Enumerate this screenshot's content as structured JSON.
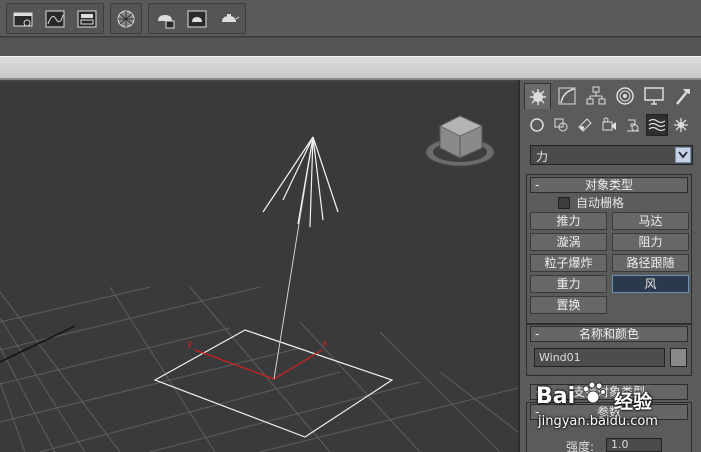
{
  "toolbar": {
    "icons": [
      "scene-explorer-icon",
      "curve-editor-icon",
      "schematic-view-icon",
      "material-editor-icon",
      "render-setup-icon",
      "rendered-frame-icon",
      "render-teapot-icon"
    ]
  },
  "viewport": {
    "axis_y_label": "y",
    "axis_x_label": "x"
  },
  "command_panel": {
    "tabs": [
      "create-tab",
      "modify-tab",
      "hierarchy-tab",
      "motion-tab",
      "display-tab",
      "utilities-tab"
    ],
    "subtabs": [
      "geometry-tab",
      "shapes-tab",
      "lights-tab",
      "cameras-tab",
      "helpers-tab",
      "space-warps-tab",
      "systems-tab"
    ],
    "category_dropdown": "力",
    "object_type": {
      "title": "对象类型",
      "toggle": "-",
      "autogrid_label": "自动栅格",
      "buttons": [
        {
          "label": "推力"
        },
        {
          "label": "马达"
        },
        {
          "label": "漩涡"
        },
        {
          "label": "阻力"
        },
        {
          "label": "粒子爆炸"
        },
        {
          "label": "路径跟随"
        },
        {
          "label": "重力"
        },
        {
          "label": "风"
        },
        {
          "label": "置换"
        }
      ],
      "selected": "风"
    },
    "name_and_color": {
      "title": "名称和颜色",
      "toggle": "-",
      "name_value": "Wind01",
      "swatch_color": "#8a8a8a"
    },
    "supports_objects": {
      "title": "支持对象类型",
      "toggle": "+"
    },
    "parameters": {
      "title": "参数",
      "toggle": "-",
      "strength_label": "强度:",
      "strength_value": "1.0"
    }
  },
  "watermark": {
    "brand": "Bai",
    "brand2": "经验",
    "url": "jingyan.baidu.com"
  },
  "colors": {
    "viewport_bg": "#3a3a3a",
    "panel_bg": "#5b5b5b",
    "selected_button": "#2b3a4a",
    "axis_red": "#d42020"
  }
}
